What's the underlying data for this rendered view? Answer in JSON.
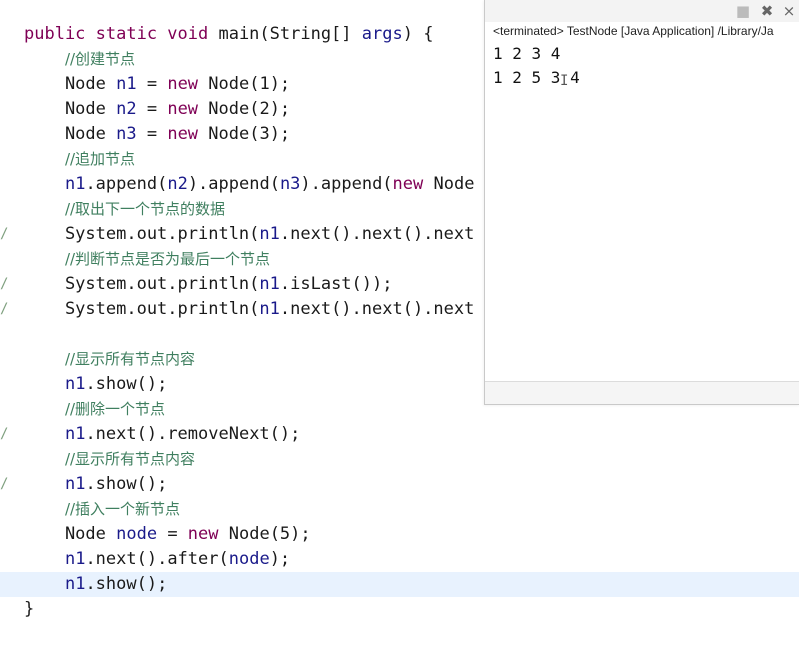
{
  "editor": {
    "lines": [
      {
        "id": "l0",
        "segments": [
          {
            "t": "public static void ",
            "c": "kw"
          },
          {
            "t": "main(String[] ",
            "c": ""
          },
          {
            "t": "args",
            "c": "var"
          },
          {
            "t": ") {",
            "c": ""
          }
        ]
      },
      {
        "id": "l1",
        "segments": [
          {
            "t": "    ",
            "c": ""
          },
          {
            "t": "//创建节点",
            "c": "cmt"
          }
        ]
      },
      {
        "id": "l2",
        "segments": [
          {
            "t": "    Node ",
            "c": ""
          },
          {
            "t": "n1",
            "c": "var"
          },
          {
            "t": " = ",
            "c": ""
          },
          {
            "t": "new",
            "c": "kw"
          },
          {
            "t": " Node(1);",
            "c": ""
          }
        ]
      },
      {
        "id": "l3",
        "segments": [
          {
            "t": "    Node ",
            "c": ""
          },
          {
            "t": "n2",
            "c": "var"
          },
          {
            "t": " = ",
            "c": ""
          },
          {
            "t": "new",
            "c": "kw"
          },
          {
            "t": " Node(2);",
            "c": ""
          }
        ]
      },
      {
        "id": "l4",
        "segments": [
          {
            "t": "    Node ",
            "c": ""
          },
          {
            "t": "n3",
            "c": "var"
          },
          {
            "t": " = ",
            "c": ""
          },
          {
            "t": "new",
            "c": "kw"
          },
          {
            "t": " Node(3);",
            "c": ""
          }
        ]
      },
      {
        "id": "l5",
        "segments": [
          {
            "t": "    ",
            "c": ""
          },
          {
            "t": "//追加节点",
            "c": "cmt"
          }
        ]
      },
      {
        "id": "l6",
        "segments": [
          {
            "t": "    ",
            "c": ""
          },
          {
            "t": "n1",
            "c": "var"
          },
          {
            "t": ".append(",
            "c": ""
          },
          {
            "t": "n2",
            "c": "var"
          },
          {
            "t": ").append(",
            "c": ""
          },
          {
            "t": "n3",
            "c": "var"
          },
          {
            "t": ").append(",
            "c": ""
          },
          {
            "t": "new",
            "c": "kw"
          },
          {
            "t": " Node",
            "c": ""
          }
        ]
      },
      {
        "id": "l7",
        "segments": [
          {
            "t": "    ",
            "c": ""
          },
          {
            "t": "//取出下一个节点的数据",
            "c": "cmt"
          }
        ]
      },
      {
        "id": "l8",
        "segments": [
          {
            "t": "    System.out.println(",
            "c": ""
          },
          {
            "t": "n1",
            "c": "var"
          },
          {
            "t": ".next().next().next",
            "c": ""
          }
        ]
      },
      {
        "id": "l9",
        "segments": [
          {
            "t": "    ",
            "c": ""
          },
          {
            "t": "//判断节点是否为最后一个节点",
            "c": "cmt"
          }
        ]
      },
      {
        "id": "l10",
        "segments": [
          {
            "t": "    System.out.println(",
            "c": ""
          },
          {
            "t": "n1",
            "c": "var"
          },
          {
            "t": ".isLast());",
            "c": ""
          }
        ]
      },
      {
        "id": "l11",
        "segments": [
          {
            "t": "    System.out.println(",
            "c": ""
          },
          {
            "t": "n1",
            "c": "var"
          },
          {
            "t": ".next().next().next",
            "c": ""
          }
        ]
      },
      {
        "id": "l12",
        "segments": []
      },
      {
        "id": "l13",
        "segments": [
          {
            "t": "    ",
            "c": ""
          },
          {
            "t": "//显示所有节点内容",
            "c": "cmt"
          }
        ]
      },
      {
        "id": "l14",
        "segments": [
          {
            "t": "    ",
            "c": ""
          },
          {
            "t": "n1",
            "c": "var"
          },
          {
            "t": ".show();",
            "c": ""
          }
        ]
      },
      {
        "id": "l15",
        "segments": [
          {
            "t": "    ",
            "c": ""
          },
          {
            "t": "//删除一个节点",
            "c": "cmt"
          }
        ]
      },
      {
        "id": "l16",
        "segments": [
          {
            "t": "    ",
            "c": ""
          },
          {
            "t": "n1",
            "c": "var"
          },
          {
            "t": ".next().removeNext();",
            "c": ""
          }
        ]
      },
      {
        "id": "l17",
        "segments": [
          {
            "t": "    ",
            "c": ""
          },
          {
            "t": "//显示所有节点内容",
            "c": "cmt"
          }
        ]
      },
      {
        "id": "l18",
        "segments": [
          {
            "t": "    ",
            "c": ""
          },
          {
            "t": "n1",
            "c": "var"
          },
          {
            "t": ".show();",
            "c": ""
          }
        ]
      },
      {
        "id": "l19",
        "segments": [
          {
            "t": "    ",
            "c": ""
          },
          {
            "t": "//插入一个新节点",
            "c": "cmt"
          }
        ]
      },
      {
        "id": "l20",
        "segments": [
          {
            "t": "    Node ",
            "c": ""
          },
          {
            "t": "node",
            "c": "var"
          },
          {
            "t": " = ",
            "c": ""
          },
          {
            "t": "new",
            "c": "kw"
          },
          {
            "t": " Node(5);",
            "c": ""
          }
        ]
      },
      {
        "id": "l21",
        "segments": [
          {
            "t": "    ",
            "c": ""
          },
          {
            "t": "n1",
            "c": "var"
          },
          {
            "t": ".next().after(",
            "c": ""
          },
          {
            "t": "node",
            "c": "var"
          },
          {
            "t": ");",
            "c": ""
          }
        ]
      },
      {
        "id": "l22",
        "segments": [
          {
            "t": "    ",
            "c": ""
          },
          {
            "t": "n1",
            "c": "var"
          },
          {
            "t": ".show();",
            "c": ""
          }
        ]
      },
      {
        "id": "l23",
        "segments": [
          {
            "t": "}",
            "c": ""
          }
        ]
      }
    ],
    "highlighted_line": "l22",
    "gutter_marks": [
      "l8",
      "l10",
      "l11",
      "l16",
      "l18"
    ]
  },
  "console": {
    "header": "<terminated> TestNode [Java Application] /Library/Ja",
    "output_lines": [
      "1 2 3 4",
      "1 2 5 3 4"
    ],
    "toolbar_icons": [
      "stop-icon",
      "remove-launch-icon",
      "remove-all-terminated-icon"
    ]
  },
  "colors": {
    "keyword": "#7f0055",
    "variable": "#1a1a8a",
    "comment": "#3f7f5f",
    "highlight": "#e8f2fe"
  }
}
